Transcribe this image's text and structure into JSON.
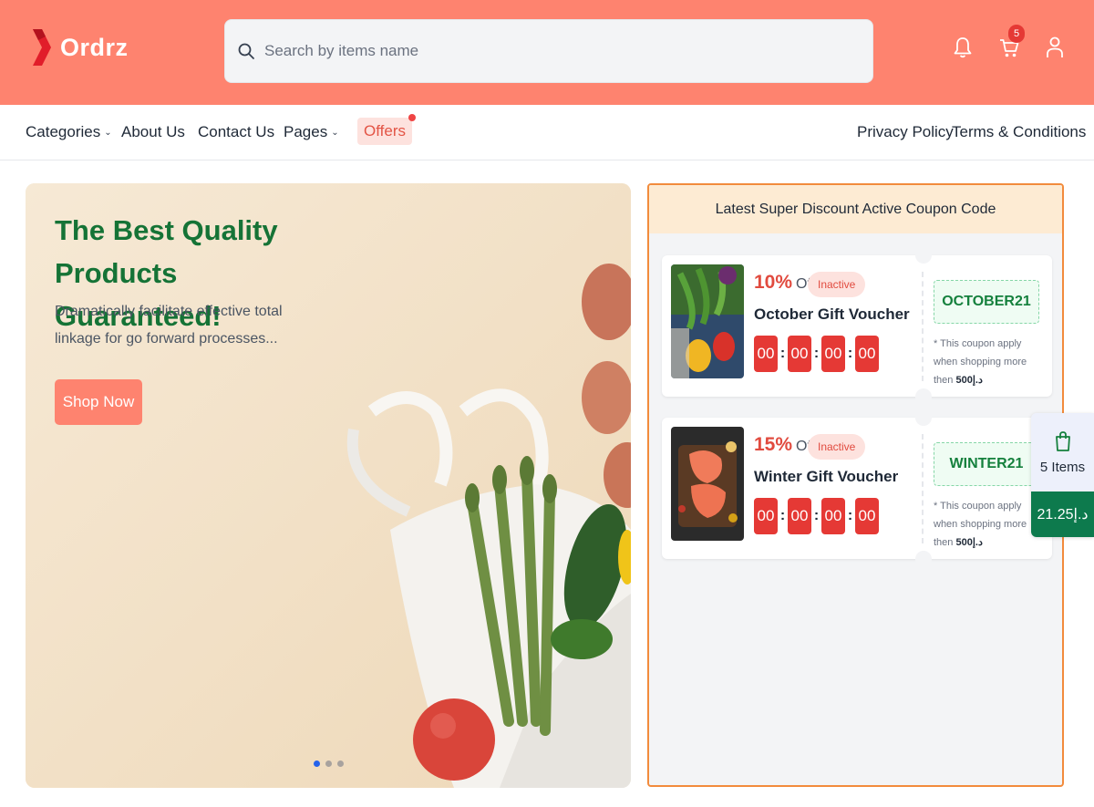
{
  "header": {
    "brand": "Ordrz",
    "search_placeholder": "Search by items name",
    "cart_count": "5",
    "icons": [
      "bell-icon",
      "cart-icon",
      "user-icon",
      "search-icon"
    ]
  },
  "nav": {
    "left": [
      {
        "label": "Categories",
        "dropdown": true
      },
      {
        "label": "About Us",
        "dropdown": false
      },
      {
        "label": "Contact Us",
        "dropdown": false
      },
      {
        "label": "Pages",
        "dropdown": true
      }
    ],
    "offers": "Offers",
    "right": [
      {
        "label": "Privacy Policy"
      },
      {
        "label": "Terms & Conditions"
      }
    ]
  },
  "hero": {
    "title": "The Best Quality Products Guaranteed!",
    "description": "Dramatically facilitate effective total linkage for go forward processes...",
    "button": "Shop Now",
    "slides": 3,
    "active_slide": 1
  },
  "coupons": {
    "heading": "Latest Super Discount Active Coupon Code",
    "items": [
      {
        "percent": "10%",
        "off_label": "Off",
        "status": "Inactive",
        "title": "October Gift Voucher",
        "timer": [
          "00",
          "00",
          "00",
          "00"
        ],
        "code": "OCTOBER21",
        "note_text": "* This coupon apply when shopping more then",
        "note_amount": "د.إ500"
      },
      {
        "percent": "15%",
        "off_label": "Off",
        "status": "Inactive",
        "title": "Winter Gift Voucher",
        "timer": [
          "00",
          "00",
          "00",
          "00"
        ],
        "code": "WINTER21",
        "note_text": "* This coupon apply when shopping more then",
        "note_amount": "د.إ500"
      }
    ]
  },
  "float_cart": {
    "items": "5 Items",
    "total": "د.إ21.25"
  },
  "colors": {
    "brand": "#fe836f",
    "green": "#157336",
    "red": "#e53935",
    "cart_total_bg": "#0d7a4d"
  }
}
